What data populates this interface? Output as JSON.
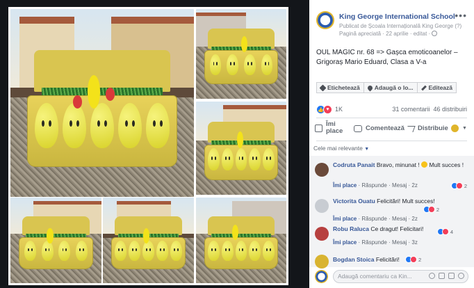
{
  "post": {
    "page_name": "King George International School",
    "published_by": "Publicat de Școala Internațională King George (?)",
    "meta": "Pagină apreciată · 22 aprilie · editat ·",
    "text": "OUL MAGIC nr. 68 => Gașca emoticoanelor – Grigoraș Mario Eduard, Clasa a V-a",
    "more": "•••"
  },
  "tag_buttons": [
    {
      "label": "Etichetează",
      "icon": "tag-icon"
    },
    {
      "label": "Adaugă o lo...",
      "icon": "location-pin-icon"
    },
    {
      "label": "Editează",
      "icon": "pencil-icon"
    }
  ],
  "reactions": {
    "count": "1K",
    "comments": "31 comentarii",
    "shares": "46 distribuiri"
  },
  "actions": {
    "like": "Îmi place",
    "comment": "Comentează",
    "share": "Distribuie"
  },
  "sort_label": "Cele mai relevante",
  "comments": [
    {
      "name": "Codruta Panait",
      "text": "Bravo, minunat ! ",
      "text2": "Mult succes !",
      "like": "Îmi place",
      "reply": "Răspunde",
      "message": "Mesaj",
      "time": "2z",
      "reacts": "2",
      "avatar": "#6b4a3a"
    },
    {
      "name": "Victorita Ouatu",
      "text": "Felicitări! Mult succes!",
      "like": "Îmi place",
      "reply": "Răspunde",
      "message": "Mesaj",
      "time": "2z",
      "reacts": "2",
      "avatar": "#c8ccd2"
    },
    {
      "name": "Robu Raluca",
      "text": "Ce dragut! Felicitari!",
      "like": "Îmi place",
      "reply": "Răspunde",
      "message": "Mesaj",
      "time": "3z",
      "reacts": "4",
      "avatar": "#b7403f"
    },
    {
      "name": "Bogdan Stoica",
      "text": "Felicitări!",
      "reacts": "2",
      "avatar": "#d9b431"
    }
  ],
  "reply_placeholder": "Adaugă comentariu ca Kin...",
  "colors": {
    "link": "#385898",
    "like_blue": "#2078f4",
    "love_red": "#f33e58",
    "tray_yellow": "#e8d25a"
  }
}
